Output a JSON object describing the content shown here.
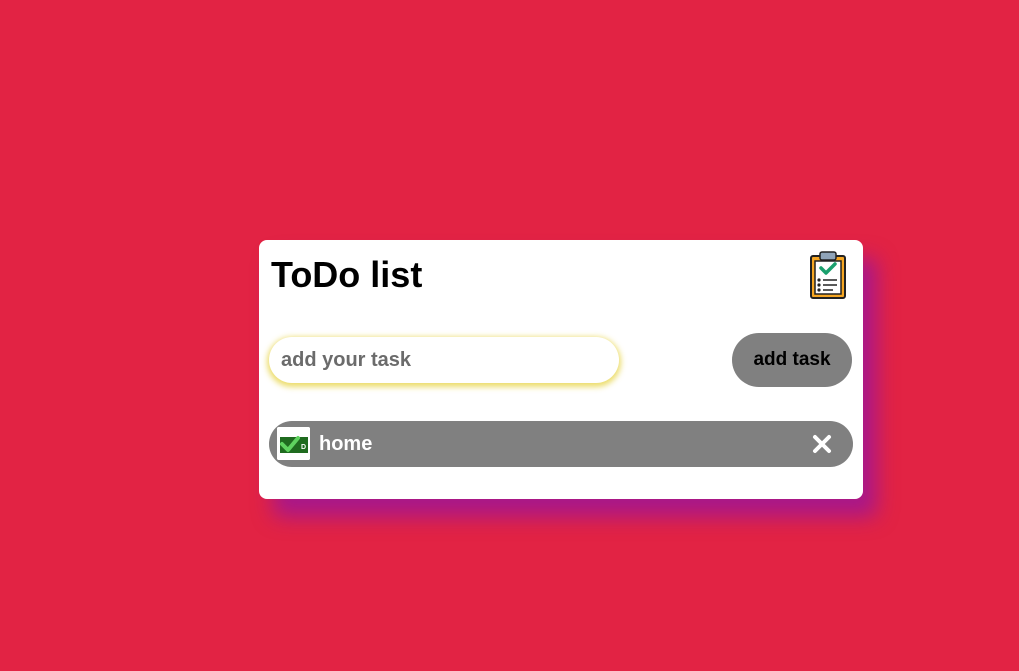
{
  "app": {
    "title": "ToDo list"
  },
  "header_icon": "clipboard-check-icon",
  "input": {
    "value": "",
    "placeholder": "add your task"
  },
  "add_button": {
    "label": "add task"
  },
  "tasks": [
    {
      "label": "home",
      "status_icon": "check-icon",
      "delete_icon": "close-icon"
    }
  ],
  "colors": {
    "background": "#e22344",
    "card": "#ffffff",
    "button": "#808080",
    "task_item": "#808080",
    "input_glow": "#e6d23c",
    "card_shadow": "#9614a0"
  }
}
